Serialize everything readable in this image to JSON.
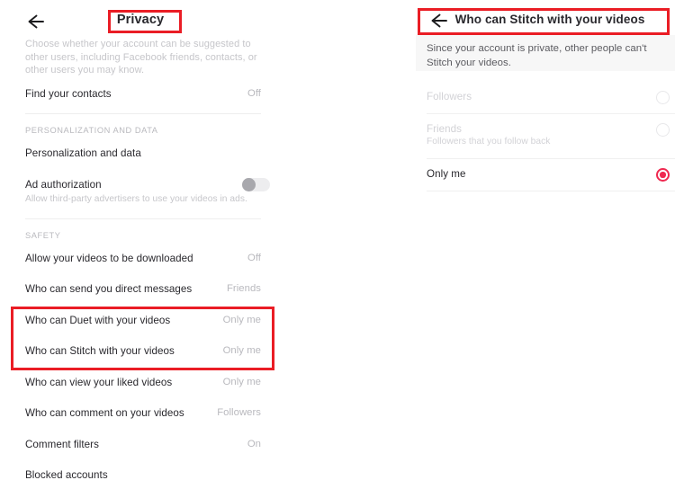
{
  "left_panel": {
    "back_icon": "back-arrow-icon",
    "title": "Privacy",
    "description": "Choose whether your account can be suggested to other users, including Facebook friends, contacts, or other users you may know.",
    "rows_top": [
      {
        "label": "Find your contacts",
        "value": "Off"
      }
    ],
    "section_personalization": {
      "header": "PERSONALIZATION AND DATA",
      "rows": [
        {
          "label": "Personalization and data",
          "value": ""
        },
        {
          "label": "Ad authorization",
          "value": "",
          "sub": "Allow third-party advertisers to use your videos in ads.",
          "toggle": "off"
        }
      ]
    },
    "section_safety": {
      "header": "SAFETY",
      "rows": [
        {
          "label": "Allow your videos to be downloaded",
          "value": "Off"
        },
        {
          "label": "Who can send you direct messages",
          "value": "Friends"
        },
        {
          "label": "Who can Duet with your videos",
          "value": "Only me"
        },
        {
          "label": "Who can Stitch with your videos",
          "value": "Only me"
        },
        {
          "label": "Who can view your liked videos",
          "value": "Only me"
        },
        {
          "label": "Who can comment on your videos",
          "value": "Followers"
        },
        {
          "label": "Comment filters",
          "value": "On"
        },
        {
          "label": "Blocked accounts",
          "value": ""
        }
      ]
    }
  },
  "right_panel": {
    "back_icon": "back-arrow-icon",
    "title": "Who can Stitch with your videos",
    "notice": "Since your account is private, other people can't Stitch your videos.",
    "options": [
      {
        "label": "Followers",
        "sub": "",
        "selected": false,
        "enabled": false
      },
      {
        "label": "Friends",
        "sub": "Followers that you follow back",
        "selected": false,
        "enabled": false
      },
      {
        "label": "Only me",
        "sub": "",
        "selected": true,
        "enabled": true
      }
    ]
  },
  "annotations": {
    "highlight_color": "#ea1d25",
    "boxes": [
      {
        "name": "privacy-title-highlight"
      },
      {
        "name": "duet-stitch-rows-highlight"
      },
      {
        "name": "stitch-header-highlight"
      }
    ]
  },
  "theme": {
    "accent": "#ef2950",
    "text_primary": "#29282d",
    "text_muted": "#b9b9be"
  }
}
